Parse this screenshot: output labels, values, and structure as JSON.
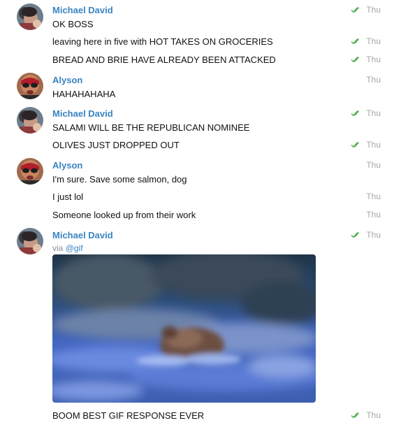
{
  "messages": [
    {
      "sender": "Michael David",
      "text": "OK BOSS",
      "time": "Thu",
      "read": true
    },
    {
      "text": "leaving here in five with HOT TAKES ON GROCERIES",
      "time": "Thu",
      "read": true
    },
    {
      "text": "BREAD AND BRIE HAVE ALREADY BEEN ATTACKED",
      "time": "Thu",
      "read": true
    },
    {
      "sender": "Alyson",
      "text": "HAHAHAHAHA",
      "time": "Thu",
      "read": false
    },
    {
      "sender": "Michael David",
      "text": "SALAMI WILL BE THE REPUBLICAN NOMINEE",
      "time": "Thu",
      "read": true
    },
    {
      "text": "OLIVES JUST DROPPED OUT",
      "time": "Thu",
      "read": true
    },
    {
      "sender": "Alyson",
      "text": "I'm sure. Save some salmon, dog",
      "time": "Thu",
      "read": false
    },
    {
      "text": "I just lol",
      "time": "Thu",
      "read": false
    },
    {
      "text": "Someone looked up from their work",
      "time": "Thu",
      "read": false
    },
    {
      "sender": "Michael David",
      "via_prefix": "via",
      "via_handle": "@gif",
      "time": "Thu",
      "read": true
    },
    {
      "text": "BOOM BEST GIF RESPONSE EVER",
      "time": "Thu",
      "read": true
    }
  ],
  "colors": {
    "sender": "#3a84c1",
    "read_check": "#4fae4e",
    "timestamp": "#a2a6ab"
  },
  "icons": {
    "read_receipt": "double-check-icon",
    "avatar_michael": "avatar-michael-david",
    "avatar_alyson": "avatar-alyson"
  }
}
